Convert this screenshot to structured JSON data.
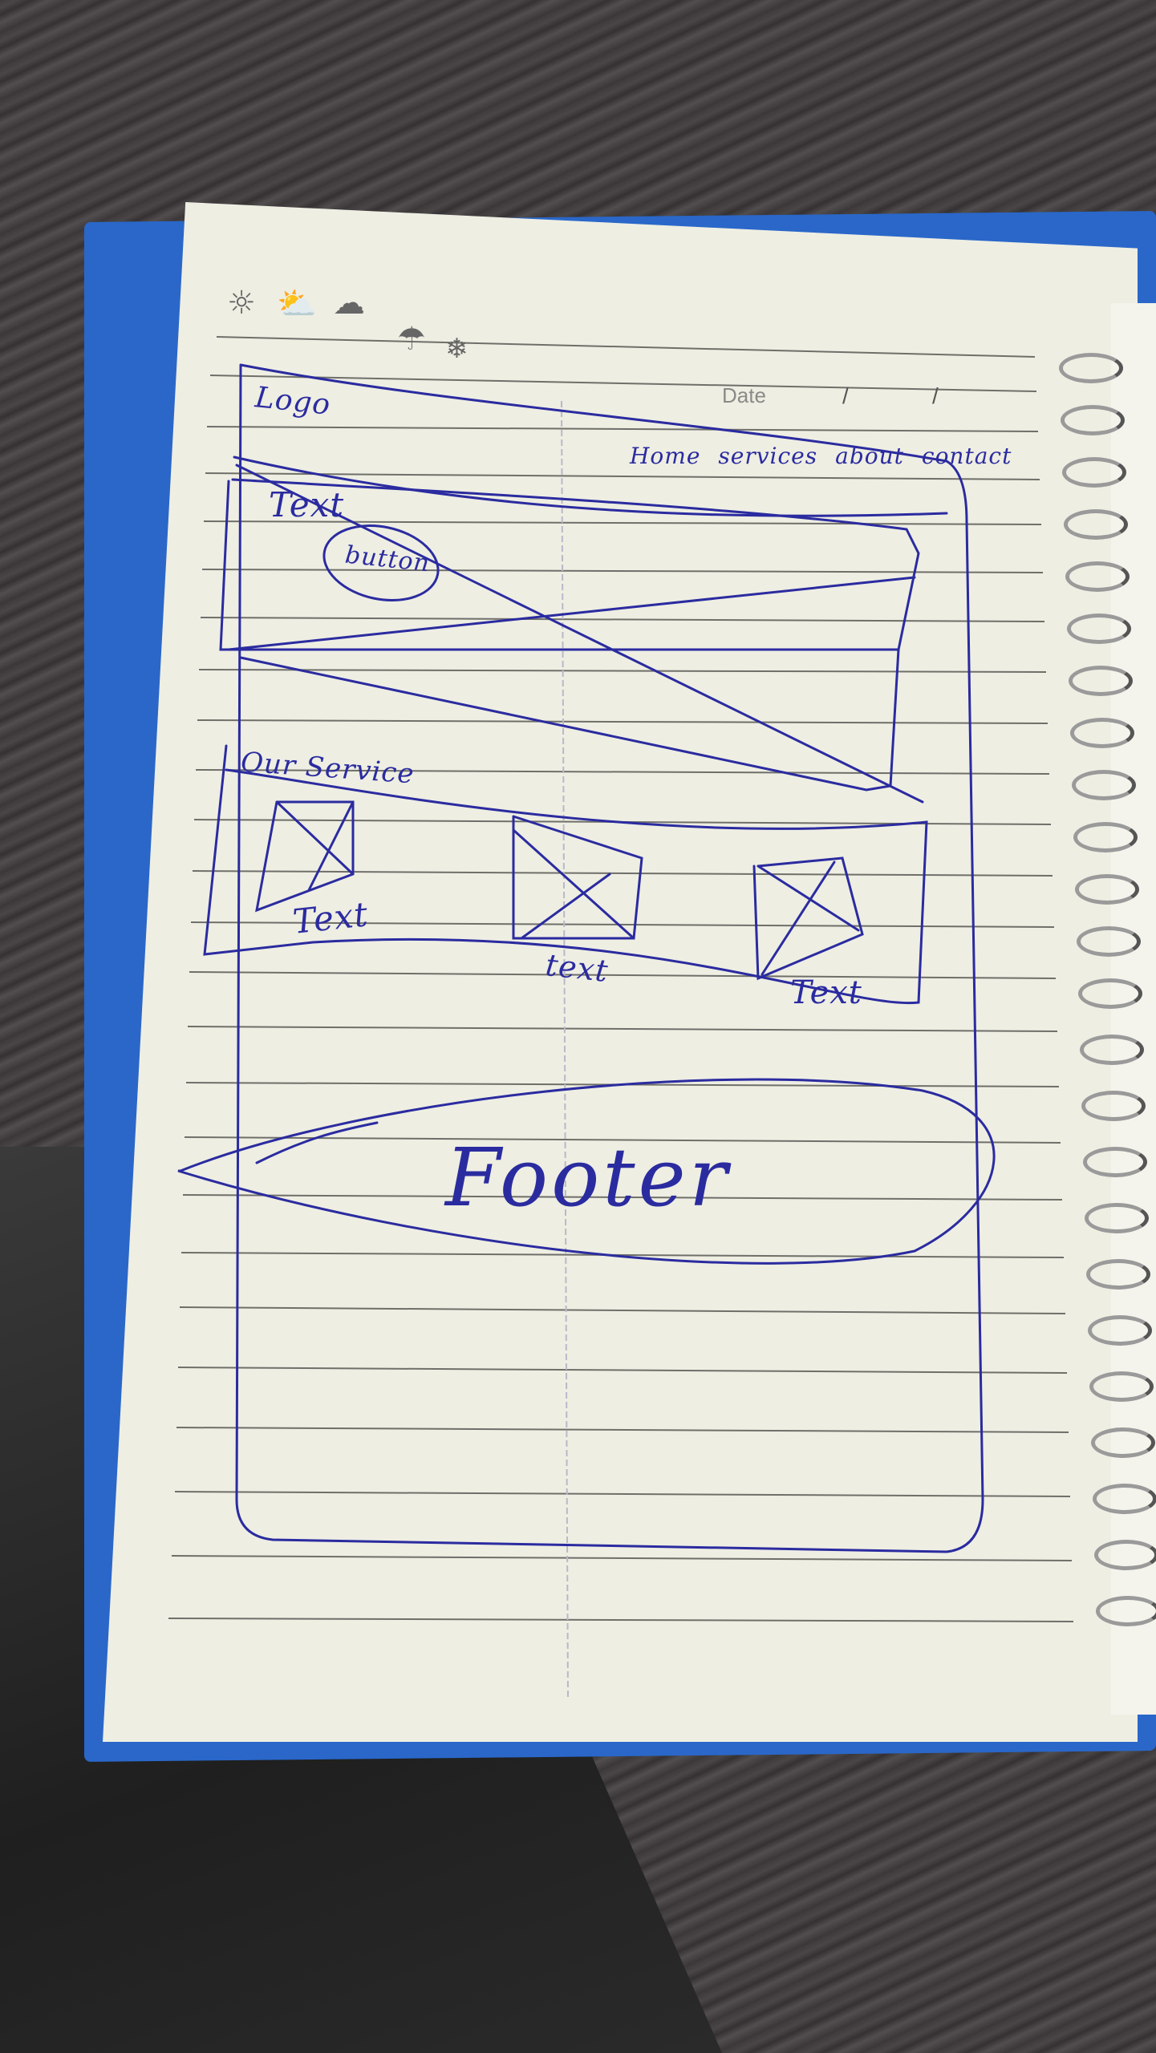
{
  "notebook": {
    "date_label": "Date",
    "date_separator": "/",
    "weather_icons": [
      "sun-icon",
      "partly-cloudy-icon",
      "cloud-icon",
      "umbrella-icon",
      "snowflake-icon"
    ]
  },
  "sketch": {
    "header": {
      "logo": "Logo",
      "nav": [
        "Home",
        "services",
        "about",
        "contact"
      ]
    },
    "hero": {
      "text": "Text",
      "button": "button"
    },
    "services": {
      "heading": "Our Service",
      "cards": [
        {
          "label": "Text"
        },
        {
          "label": "text"
        },
        {
          "label": "Text"
        }
      ]
    },
    "footer": {
      "label": "Footer"
    }
  },
  "colors": {
    "ink": "#2b2ba0",
    "paper": "#eeeee3",
    "cover": "#2a67c9"
  }
}
